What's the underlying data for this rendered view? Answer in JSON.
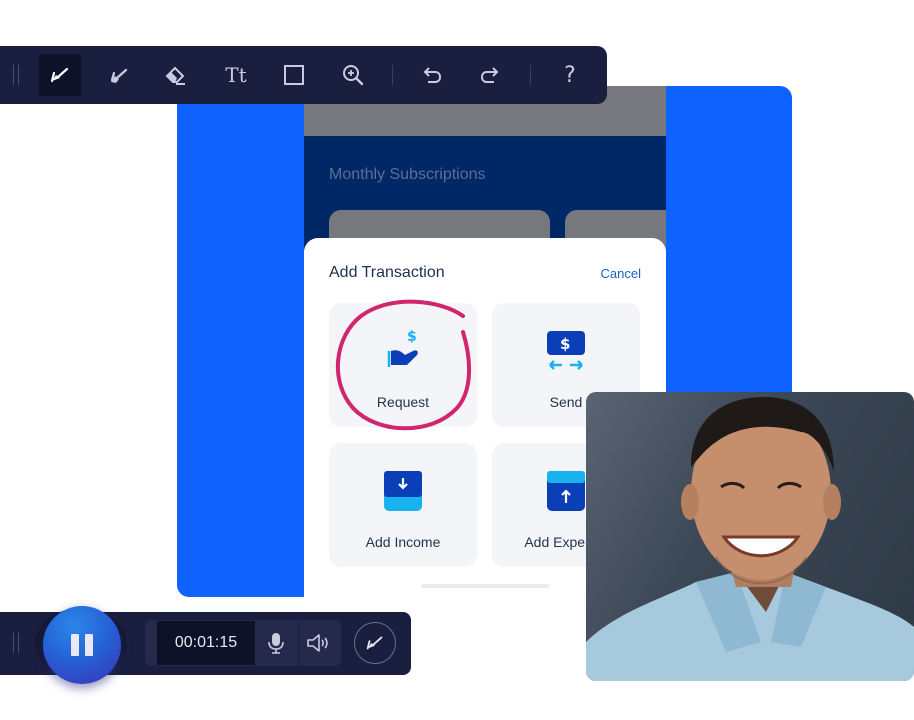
{
  "toolbar": {
    "tools": [
      {
        "name": "pen",
        "icon": "pen-icon",
        "active": true
      },
      {
        "name": "highlighter",
        "icon": "highlighter-icon",
        "active": false
      },
      {
        "name": "eraser",
        "icon": "eraser-icon",
        "active": false
      },
      {
        "name": "text",
        "icon": "text-icon",
        "label": "Tt",
        "active": false
      },
      {
        "name": "rectangle",
        "icon": "rectangle-icon",
        "active": false
      },
      {
        "name": "zoom",
        "icon": "zoom-in-icon",
        "active": false
      },
      {
        "name": "undo",
        "icon": "undo-icon",
        "active": false
      },
      {
        "name": "redo",
        "icon": "redo-icon",
        "active": false
      },
      {
        "name": "help",
        "icon": "help-icon",
        "label": "?",
        "active": false
      }
    ]
  },
  "app": {
    "section_title": "Monthly Subscriptions",
    "modal": {
      "title": "Add Transaction",
      "cancel_label": "Cancel",
      "tiles": [
        {
          "label": "Request",
          "icon": "request-money-icon"
        },
        {
          "label": "Send",
          "icon": "send-money-icon"
        },
        {
          "label": "Add Income",
          "icon": "add-income-icon"
        },
        {
          "label": "Add Expense",
          "icon": "add-expense-icon"
        }
      ]
    },
    "colors": {
      "backdrop_blue": "#0f62fe",
      "navy": "#002766",
      "annotation": "#d1256e",
      "icon_dark": "#0a3fb8",
      "icon_light": "#19b2f0"
    }
  },
  "recorder": {
    "timer": "00:01:15",
    "pause_icon": "pause-icon",
    "mic_icon": "microphone-icon",
    "volume_icon": "speaker-icon",
    "draw_icon": "pen-icon"
  },
  "webcam": {
    "description": "Smiling man in light blue denim shirt against dark gray background"
  }
}
